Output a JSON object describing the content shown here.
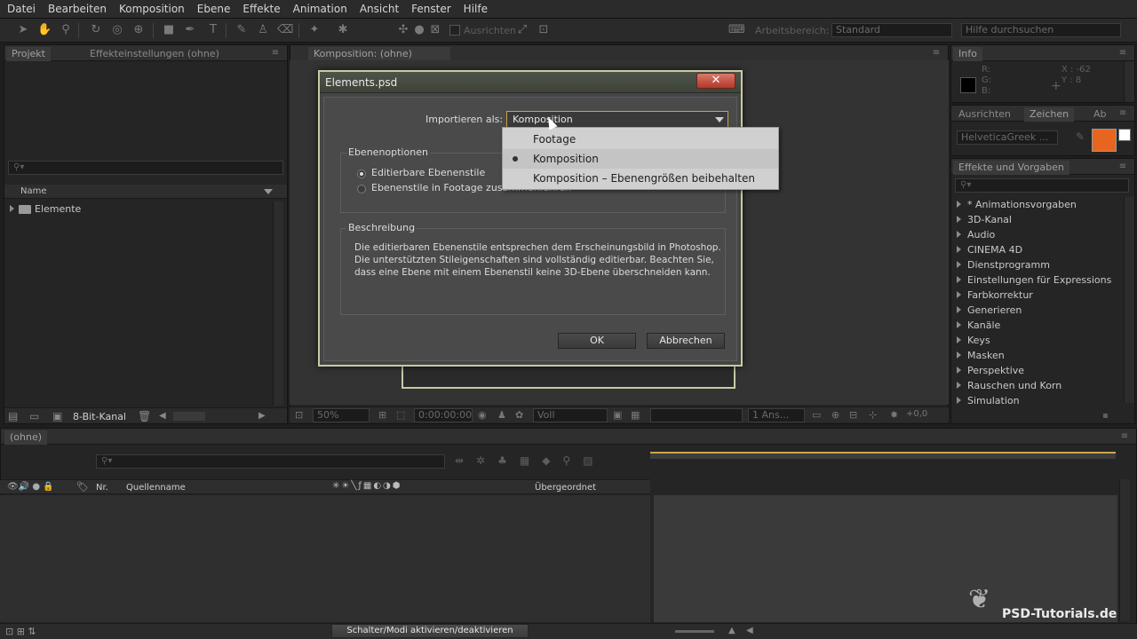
{
  "menu": [
    "Datei",
    "Bearbeiten",
    "Komposition",
    "Ebene",
    "Effekte",
    "Animation",
    "Ansicht",
    "Fenster",
    "Hilfe"
  ],
  "toolbar": {
    "align_label": "Ausrichten",
    "workspace_label": "Arbeitsbereich:",
    "workspace_value": "Standard",
    "help_search_placeholder": "Hilfe durchsuchen"
  },
  "project_panel": {
    "tab_project": "Projekt",
    "tab_effect_settings": "Effekteinstellungen (ohne)",
    "col_name": "Name",
    "items": [
      "Elemente"
    ],
    "bit_depth": "8-Bit-Kanal"
  },
  "comp_panel": {
    "tab": "Komposition: (ohne)",
    "zoom": "50%",
    "timecode": "0:00:00:00",
    "quality": "Voll",
    "views": "1 Ans...",
    "offset": "+0,0"
  },
  "info_panel": {
    "tab": "Info",
    "r": "R:",
    "g": "G:",
    "b": "B:",
    "x": "X : -62",
    "y": "Y : 8"
  },
  "char_panel": {
    "tab_align": "Ausrichten",
    "tab_char": "Zeichen",
    "tab_extra": "Ab",
    "font": "HelveticaGreek ...",
    "swatch_color": "#e8651f"
  },
  "effects_panel": {
    "tab": "Effekte und Vorgaben",
    "items": [
      "* Animationsvorgaben",
      "3D-Kanal",
      "Audio",
      "CINEMA 4D",
      "Dienstprogramm",
      "Einstellungen für Expressions",
      "Farbkorrektur",
      "Generieren",
      "Kanäle",
      "Keys",
      "Masken",
      "Perspektive",
      "Rauschen und Korn",
      "Simulation"
    ]
  },
  "timeline": {
    "tab": "(ohne)",
    "col_nr": "Nr.",
    "col_source": "Quellenname",
    "col_parent": "Übergeordnet",
    "toggle_label": "Schalter/Modi aktivieren/deaktivieren"
  },
  "dialog": {
    "title": "Elements.psd",
    "close": "✕",
    "import_as_label": "Importieren als:",
    "import_as_value": "Komposition",
    "layer_options_title": "Ebenenoptionen",
    "radio_editable": "Editierbare Ebenenstile",
    "radio_merge": "Ebenenstile in Footage zusammenführen",
    "description_title": "Beschreibung",
    "description_lines": [
      "Die editierbaren Ebenenstile entsprechen dem Erscheinungsbild in Photoshop.",
      "Die unterstützten Stileigenschaften sind vollständig editierbar. Beachten Sie,",
      "dass eine Ebene mit einem Ebenenstil keine 3D-Ebene überschneiden kann."
    ],
    "ok": "OK",
    "cancel": "Abbrechen"
  },
  "dropdown": {
    "options": [
      "Footage",
      "Komposition",
      "Komposition – Ebenengrößen beibehalten"
    ],
    "selected_index": 1
  },
  "watermark": "PSD-Tutorials.de"
}
